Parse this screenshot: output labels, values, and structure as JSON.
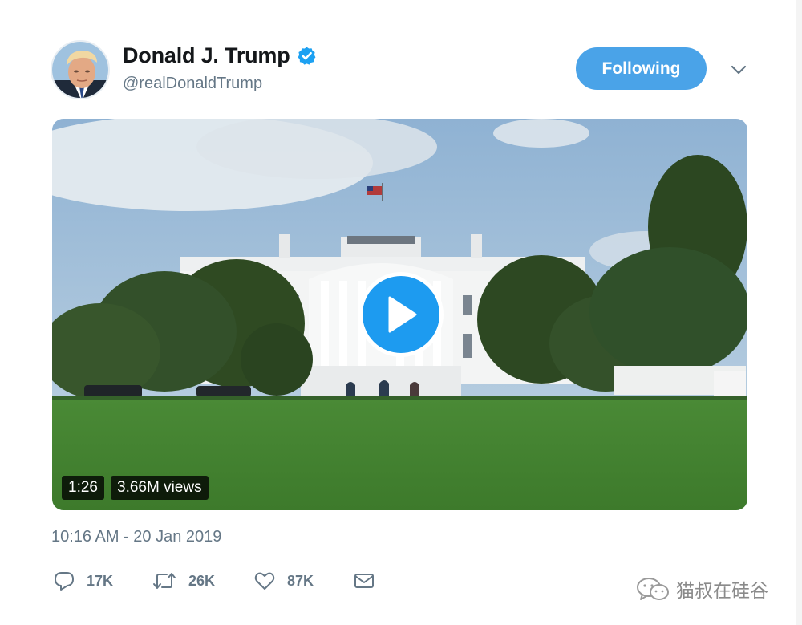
{
  "tweet": {
    "author": {
      "name": "Donald J. Trump",
      "handle": "@realDonaldTrump",
      "avatar_icon": "profile-photo",
      "verified_icon": "verified-badge-icon"
    },
    "follow_button": {
      "label": "Following"
    },
    "menu_icon": "chevron-down-icon",
    "media": {
      "type": "video",
      "duration": "1:26",
      "views": "3.66M views",
      "play_icon": "play-icon"
    },
    "timestamp": "10:16 AM - 20 Jan 2019",
    "actions": [
      {
        "icon": "reply-icon",
        "count": "17K"
      },
      {
        "icon": "retweet-icon",
        "count": "26K"
      },
      {
        "icon": "like-icon",
        "count": "87K"
      },
      {
        "icon": "direct-message-icon",
        "count": ""
      }
    ]
  },
  "watermark": {
    "text": "猫叔在硅谷",
    "icon": "wechat-icon"
  },
  "colors": {
    "accent": "#4aa3e8",
    "text": "#14171a",
    "secondary_text": "#657786"
  }
}
